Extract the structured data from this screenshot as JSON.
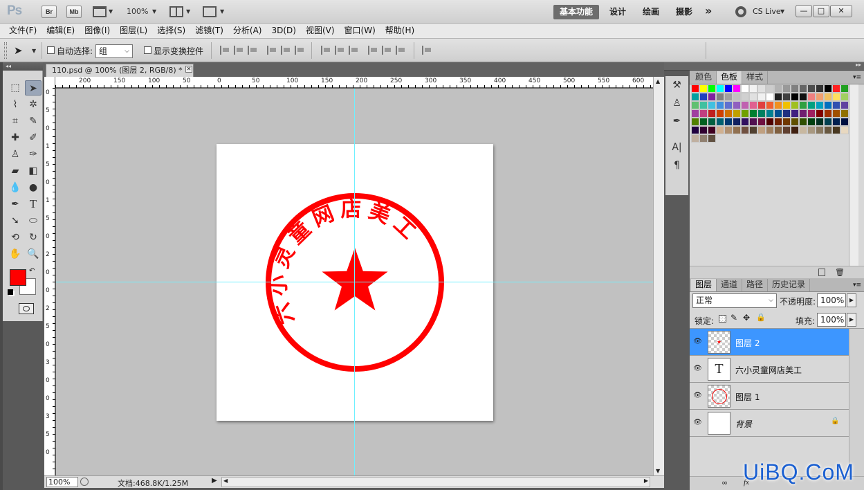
{
  "app": {
    "logo": "Ps",
    "bridge_btn": "Br",
    "minibridge_btn": "Mb",
    "zoom": "100%",
    "workspaces": [
      "基本功能",
      "设计",
      "绘画",
      "摄影"
    ],
    "more": "»",
    "cslive": "CS Live",
    "window_controls": [
      "—",
      "□",
      "✕"
    ]
  },
  "menus": [
    "文件(F)",
    "编辑(E)",
    "图像(I)",
    "图层(L)",
    "选择(S)",
    "滤镜(T)",
    "分析(A)",
    "3D(D)",
    "视图(V)",
    "窗口(W)",
    "帮助(H)"
  ],
  "options": {
    "auto_select_label": "自动选择:",
    "auto_select_value": "组",
    "show_transform_label": "显示变换控件"
  },
  "document": {
    "tab_title": "110.psd @ 100% (图层 2, RGB/8) *",
    "ruler_h_labels": [
      "200",
      "150",
      "100",
      "50",
      "0",
      "50",
      "100",
      "150",
      "200",
      "250",
      "300",
      "350",
      "400",
      "450",
      "500",
      "550",
      "600"
    ],
    "ruler_v_labels": [
      "0",
      "5",
      "0",
      "1",
      "5",
      "0",
      "1",
      "5",
      "0",
      "2",
      "0",
      "0",
      "2",
      "5",
      "0",
      "3",
      "0",
      "0",
      "3",
      "5",
      "0"
    ],
    "stamp_text": "六小灵童网店美工",
    "stamp_color": "#ff0000",
    "guide_color": "#6ff0ff"
  },
  "status": {
    "zoom": "100%",
    "doc_size": "文档:468.8K/1.25M"
  },
  "colors": {
    "foreground": "#ff0000",
    "background": "#ffffff",
    "selected_layer": "#3d96ff"
  },
  "swatches": {
    "tabs": [
      "颜色",
      "色板",
      "样式"
    ],
    "active_tab": "色板",
    "colors": [
      "#ff0000",
      "#ffff00",
      "#00ff00",
      "#00ffff",
      "#0000ff",
      "#ff00ff",
      "#ffffff",
      "#f2f2f2",
      "#e0e0e0",
      "#cccccc",
      "#b3b3b3",
      "#999999",
      "#808080",
      "#666666",
      "#4d4d4d",
      "#333333",
      "#000000",
      "#ff2020",
      "#20a020",
      "#00a0a0",
      "#2040c0",
      "#8020a0",
      "#808080",
      "#a0a0a0",
      "#c0c0c0",
      "#d0d0d0",
      "#e0e0e0",
      "#f0f0f0",
      "#ffffff",
      "#202020",
      "#404040",
      "#000000",
      "#101010",
      "#f08080",
      "#f0a070",
      "#f0c060",
      "#ffe060",
      "#a0d060",
      "#60c070",
      "#40c0a0",
      "#40c0e0",
      "#4090e0",
      "#6070d0",
      "#9060c0",
      "#c060b0",
      "#e06090",
      "#e04040",
      "#f06030",
      "#f09020",
      "#f0c000",
      "#a0c020",
      "#30a040",
      "#00a080",
      "#00a0c0",
      "#0070c0",
      "#3050b0",
      "#6040a0",
      "#a040a0",
      "#c04080",
      "#c02020",
      "#d04000",
      "#d07000",
      "#c0a000",
      "#70a000",
      "#008030",
      "#008060",
      "#008090",
      "#005090",
      "#203080",
      "#402080",
      "#702070",
      "#a02060",
      "#800000",
      "#a03000",
      "#a05000",
      "#907000",
      "#508000",
      "#006020",
      "#006040",
      "#006070",
      "#003870",
      "#102060",
      "#301060",
      "#501050",
      "#701040",
      "#500000",
      "#702000",
      "#703800",
      "#605000",
      "#305000",
      "#004010",
      "#003020",
      "#004050",
      "#002050",
      "#001040",
      "#200040",
      "#300030",
      "#400020",
      "#d0b090",
      "#b09070",
      "#907050",
      "#705040",
      "#504030",
      "#c0a080",
      "#a08060",
      "#806040",
      "#604030",
      "#402010",
      "#c8b8a0",
      "#a89880",
      "#887860",
      "#685840",
      "#483820",
      "#e8d8c0",
      "#c0b0a0",
      "#908070",
      "#605040"
    ]
  },
  "layers": {
    "tabs": [
      "图层",
      "通道",
      "路径",
      "历史记录"
    ],
    "active_tab": "图层",
    "blend_mode": "正常",
    "opacity_label": "不透明度:",
    "opacity": "100%",
    "lock_label": "锁定:",
    "fill_label": "填充:",
    "fill": "100%",
    "items": [
      {
        "name": "图层 2",
        "selected": true
      },
      {
        "name": "六小灵童网店美工",
        "selected": false
      },
      {
        "name": "图层 1",
        "selected": false
      },
      {
        "name": "背景",
        "selected": false
      }
    ],
    "text_thumb": "T"
  },
  "watermark": "UiBQ.CoM"
}
